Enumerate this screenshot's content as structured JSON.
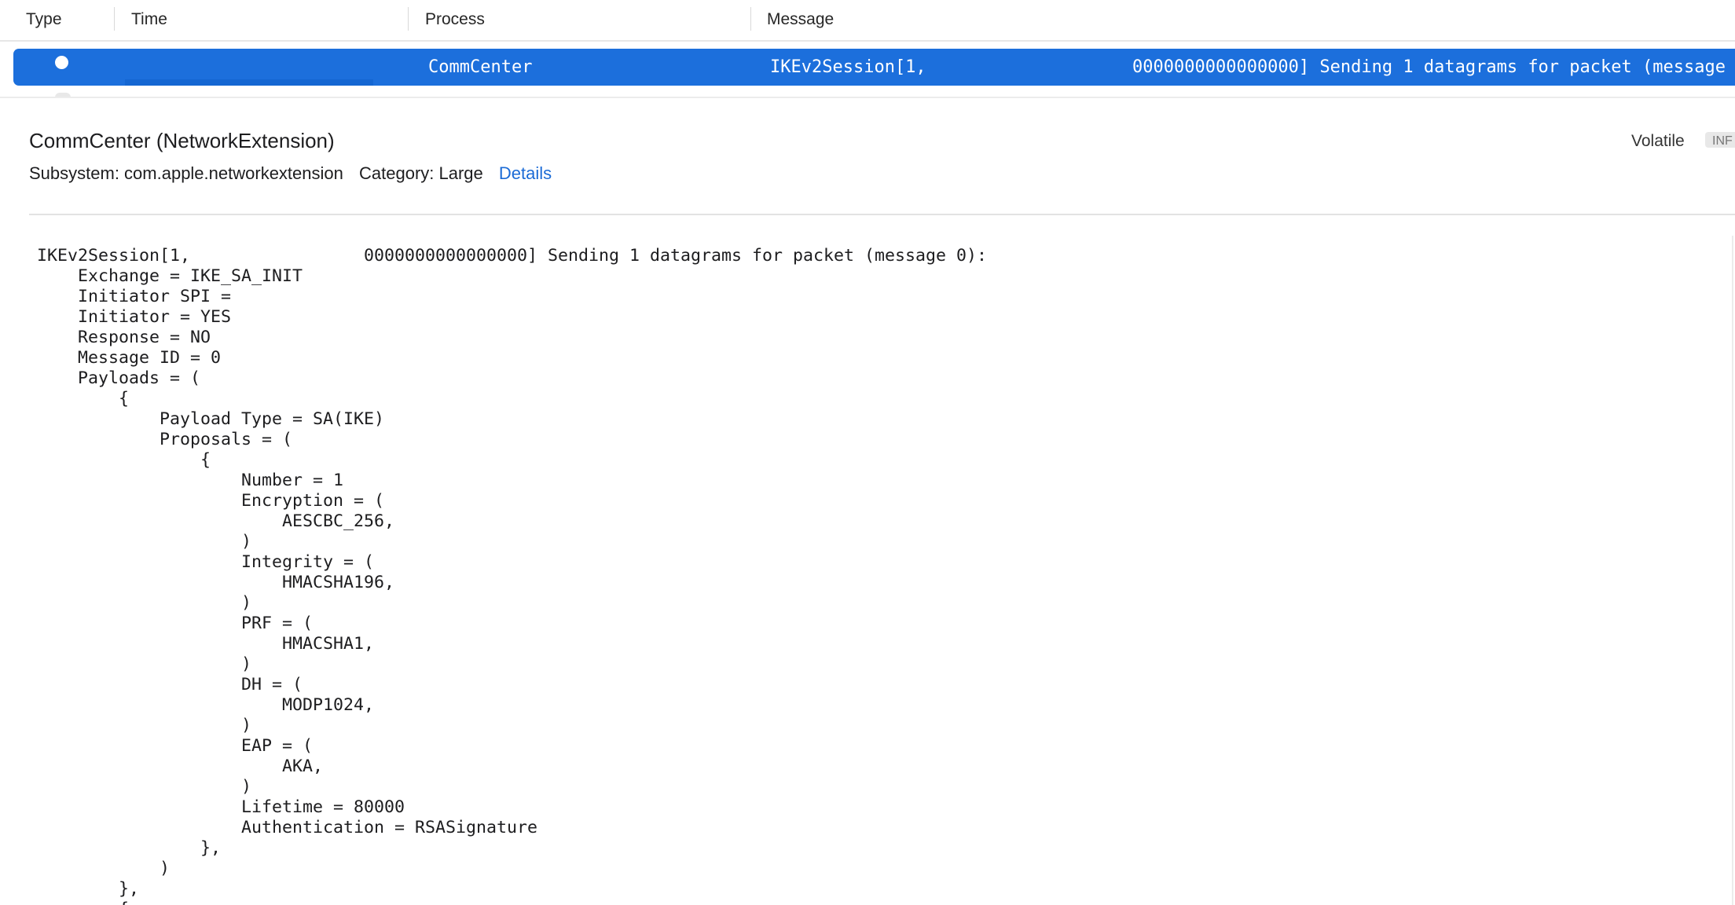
{
  "columns": {
    "type": "Type",
    "time": "Time",
    "process": "Process",
    "message": "Message"
  },
  "selected_row": {
    "process": "CommCenter",
    "message_start": "IKEv2Session[1,",
    "message_end": "0000000000000000] Sending 1 datagrams for packet (message"
  },
  "detail": {
    "title": "CommCenter (NetworkExtension)",
    "subsystem": "Subsystem: com.apple.networkextension",
    "category": "Category: Large",
    "details_link": "Details",
    "volatile": "Volatile",
    "badge": "INF"
  },
  "message_lines": [
    "IKEv2Session[1,                 0000000000000000] Sending 1 datagrams for packet (message 0):",
    "    Exchange = IKE_SA_INIT",
    "    Initiator SPI =",
    "    Initiator = YES",
    "    Response = NO",
    "    Message ID = 0",
    "    Payloads = (",
    "        {",
    "            Payload Type = SA(IKE)",
    "            Proposals = (",
    "                {",
    "                    Number = 1",
    "                    Encryption = (",
    "                        AESCBC_256,",
    "                    )",
    "                    Integrity = (",
    "                        HMACSHA196,",
    "                    )",
    "                    PRF = (",
    "                        HMACSHA1,",
    "                    )",
    "                    DH = (",
    "                        MODP1024,",
    "                    )",
    "                    EAP = (",
    "                        AKA,",
    "                    )",
    "                    Lifetime = 80000",
    "                    Authentication = RSASignature",
    "                },",
    "            )",
    "        },",
    "        {"
  ],
  "colors": {
    "selection": "#1c6fdc",
    "link": "#1b6bd6"
  }
}
